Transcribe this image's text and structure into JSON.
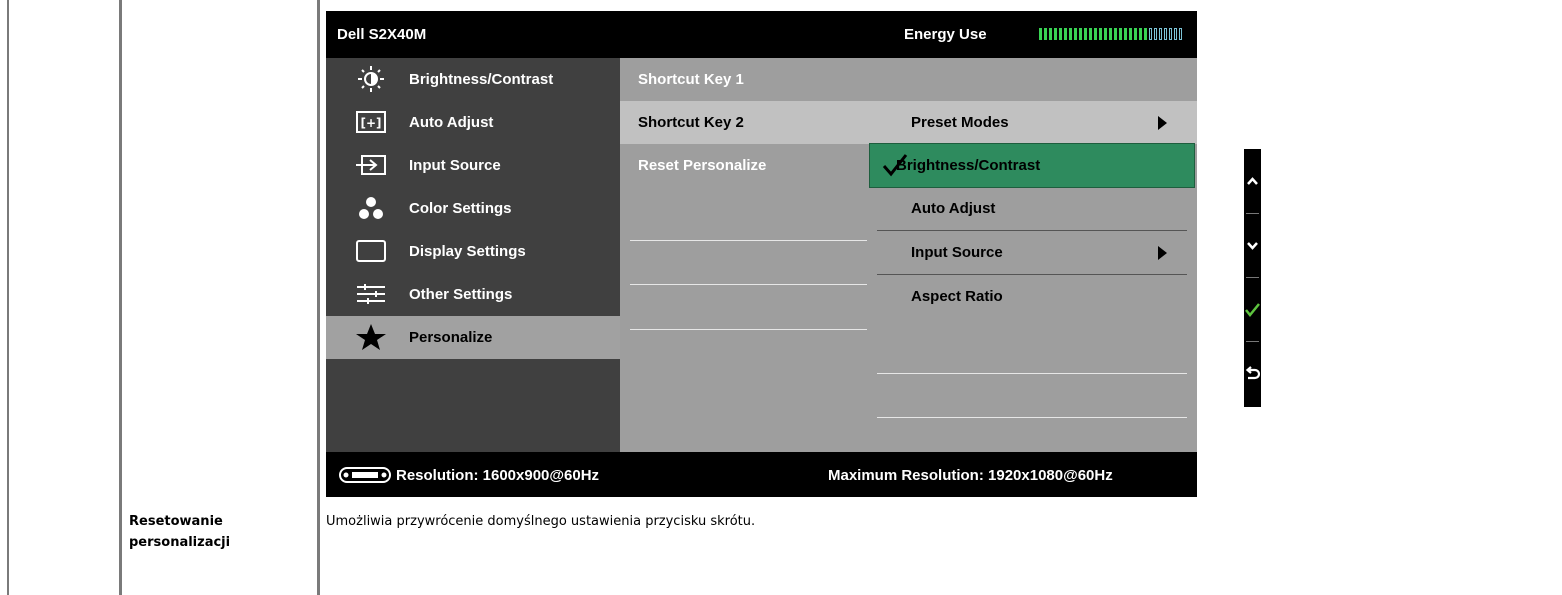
{
  "osd": {
    "model": "Dell S2X40M",
    "energy_label": "Energy Use",
    "energy_level_fraction": 0.76,
    "main_menu": [
      {
        "label": "Brightness/Contrast",
        "icon": "brightness-icon"
      },
      {
        "label": "Auto Adjust",
        "icon": "auto-adjust-icon"
      },
      {
        "label": "Input Source",
        "icon": "input-source-icon"
      },
      {
        "label": "Color Settings",
        "icon": "color-settings-icon"
      },
      {
        "label": "Display Settings",
        "icon": "display-settings-icon"
      },
      {
        "label": "Other Settings",
        "icon": "other-settings-icon"
      },
      {
        "label": "Personalize",
        "icon": "star-icon",
        "selected": true
      }
    ],
    "submenu": [
      {
        "label": "Shortcut Key 1"
      },
      {
        "label": "Shortcut Key 2",
        "highlight": true
      },
      {
        "label": "Reset Personalize"
      }
    ],
    "options": [
      {
        "label": "Preset Modes",
        "arrow": true
      },
      {
        "label": "Brightness/Contrast",
        "selected": true
      },
      {
        "label": "Auto Adjust"
      },
      {
        "label": "Input Source",
        "arrow": true
      },
      {
        "label": "Aspect Ratio"
      }
    ],
    "footer": {
      "resolution": "Resolution: 1600x900@60Hz",
      "max_resolution": "Maximum Resolution: 1920x1080@60Hz"
    },
    "accent_color": "#2e8b5e"
  },
  "side_buttons": [
    {
      "icon": "chevron-up-icon"
    },
    {
      "icon": "chevron-down-icon"
    },
    {
      "icon": "check-icon"
    },
    {
      "icon": "back-icon"
    }
  ],
  "doc": {
    "title_line1": "Resetowanie",
    "title_line2": "personalizacji",
    "description": "Umożliwia przywrócenie domyślnego ustawienia przycisku skrótu."
  }
}
